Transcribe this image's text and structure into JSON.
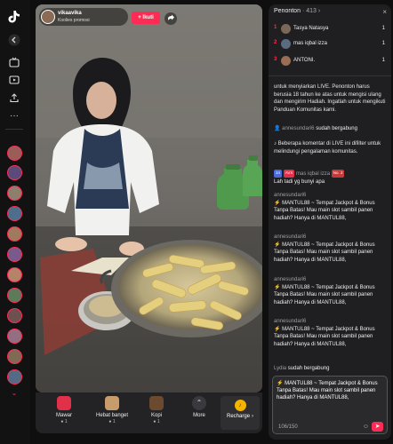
{
  "rail": {
    "icons": [
      "tiktok-logo-icon",
      "back-arrow-icon",
      "live-tv-icon",
      "video-icon",
      "upload-icon",
      "more-icon"
    ],
    "more_label": "···"
  },
  "host": {
    "name": "vikaavika",
    "subtitle": "Koolies promosi",
    "follow_label": "+ Ikuti"
  },
  "gifts": [
    {
      "name": "Mawar",
      "price": "1",
      "color": "#e0304a"
    },
    {
      "name": "Hebat banget",
      "price": "1",
      "color": "#c89b6a"
    },
    {
      "name": "Kopi",
      "price": "1",
      "color": "#6b4a2f"
    },
    {
      "name": "More",
      "price": "",
      "color": "#3a3a3e"
    }
  ],
  "recharge_label": "Recharge",
  "recharge_chevron": "›",
  "viewers": {
    "title": "Penonton",
    "count": "413",
    "top": [
      {
        "rank": "1",
        "name": "Tasya Natasya",
        "score": "1"
      },
      {
        "rank": "2",
        "name": "mas iqbal izza",
        "score": "1"
      },
      {
        "rank": "3",
        "name": "ANTONI.",
        "score": "1"
      }
    ]
  },
  "chat": [
    {
      "type": "sys",
      "text": "untuk menyiarkan LIVE. Penonton harus berusia 18 tahun ke atas untuk mengisi ulang dan mengirim Hadiah. Ingatlah untuk mengikuti Panduan Komunitas kami."
    },
    {
      "type": "join",
      "user": "annesundari6",
      "text": "sudah bergabung"
    },
    {
      "type": "sys",
      "text": "Beberapa komentar di LIVE ini difilter untuk melindungi pengalaman komunitas."
    },
    {
      "type": "badge_msg",
      "b1": "34",
      "b2": "AVX",
      "user": "mas iqbal izza",
      "b3": "No. 2",
      "text": "Lah tadi yg bunyi apa"
    },
    {
      "type": "msg",
      "user": "annesundari6",
      "text": "MANTUL88 ~ Tempat Jackpot & Bonus Tanpa Batas!    Mau main slot sambil panen hadiah? Hanya di MANTUL88,"
    },
    {
      "type": "msg",
      "user": "annesundari6",
      "text": "MANTUL88 ~ Tempat Jackpot & Bonus Tanpa Batas!    Mau main slot sambil panen hadiah? Hanya di MANTUL88,"
    },
    {
      "type": "msg",
      "user": "annesundari6",
      "text": "MANTUL88 ~ Tempat Jackpot & Bonus Tanpa Batas!    Mau main slot sambil panen hadiah? Hanya di MANTUL88,"
    },
    {
      "type": "msg",
      "user": "annesundari6",
      "text": "MANTUL88 ~ Tempat Jackpot & Bonus Tanpa Batas!    Mau main slot sambil panen hadiah? Hanya di MANTUL88,"
    },
    {
      "type": "join",
      "user": "Lydia",
      "text": "sudah bergabung"
    }
  ],
  "compose": {
    "text": "MANTUL88 ~ Tempat Jackpot & Bonus Tanpa Batas!    Mau main slot sambil panen hadiah? Hanya di MANTUL88,",
    "counter": "106/150"
  },
  "colors": {
    "accent": "#fe2c55",
    "panel": "#1f1f21",
    "coin": "#f5b400"
  }
}
